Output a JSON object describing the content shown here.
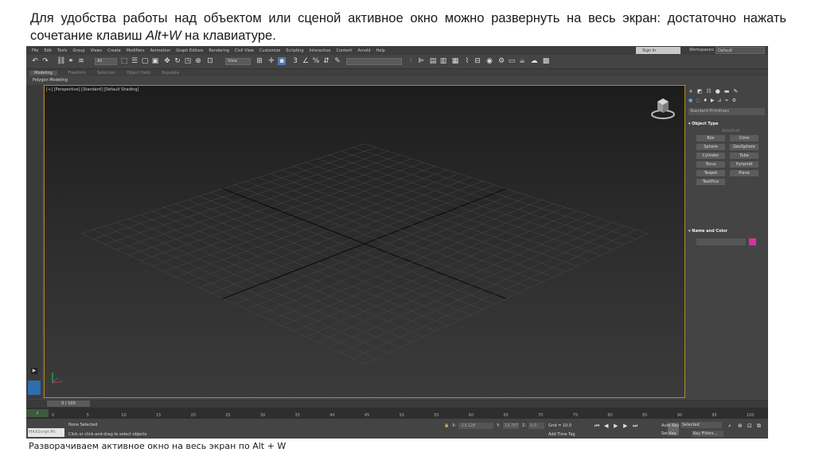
{
  "slide": {
    "caption_pre": "Для удобства работы над объектом или сценой активное окно можно развернуть на весь экран: достаточно нажать сочетание клавиш ",
    "caption_keys": "Alt+W",
    "caption_post": " на клавиатуре.",
    "bottom_caption": "Разворачиваем активное окно на весь экран по Alt + W"
  },
  "menu": [
    "File",
    "Edit",
    "Tools",
    "Group",
    "Views",
    "Create",
    "Modifiers",
    "Animation",
    "Graph Editors",
    "Rendering",
    "Civil View",
    "Customize",
    "Scripting",
    "Interactive",
    "Content",
    "Arnold",
    "Help"
  ],
  "header": {
    "signin_label": "Sign In",
    "workspaces_label": "Workspaces:",
    "workspace_value": "Default"
  },
  "toolbar": {
    "selection_filter": "All",
    "reference_coord": "View",
    "named_selection": ""
  },
  "ribbon": {
    "tabs": [
      "Modeling",
      "Freeform",
      "Selection",
      "Object Paint",
      "Populate"
    ],
    "active": "Modeling",
    "sub_tab": "Polygon Modeling"
  },
  "viewport": {
    "label": "[+] [Perspective] [Standard] [Default Shading]"
  },
  "command_panel": {
    "dropdown": "Standard Primitives",
    "section_object_type": "Object Type",
    "autogrid": "AutoGrid",
    "buttons": [
      "Box",
      "Cone",
      "Sphere",
      "GeoSphere",
      "Cylinder",
      "Tube",
      "Torus",
      "Pyramid",
      "Teapot",
      "Plane",
      "TextPlus"
    ],
    "section_name_color": "Name and Color",
    "object_color": "#d6339d"
  },
  "timeline": {
    "slider_label": "0 / 100",
    "ticks": [
      "0",
      "5",
      "10",
      "15",
      "20",
      "25",
      "30",
      "35",
      "40",
      "45",
      "50",
      "55",
      "60",
      "65",
      "70",
      "75",
      "80",
      "85",
      "90",
      "95",
      "100"
    ]
  },
  "status": {
    "maxscript": "MAXScript Mi:",
    "selection": "None Selected",
    "hint": "Click or click-and-drag to select objects",
    "x_label": "X:",
    "x_value": "-13,128",
    "y_label": "Y:",
    "y_value": "13,707",
    "z_label": "Z:",
    "z_value": "0,0",
    "grid": "Grid = 10,0",
    "add_time_tag": "Add Time Tag",
    "auto_key": "Auto Key",
    "set_key": "Set Key",
    "selected": "Selected",
    "key_filters": "Key Filters..."
  }
}
